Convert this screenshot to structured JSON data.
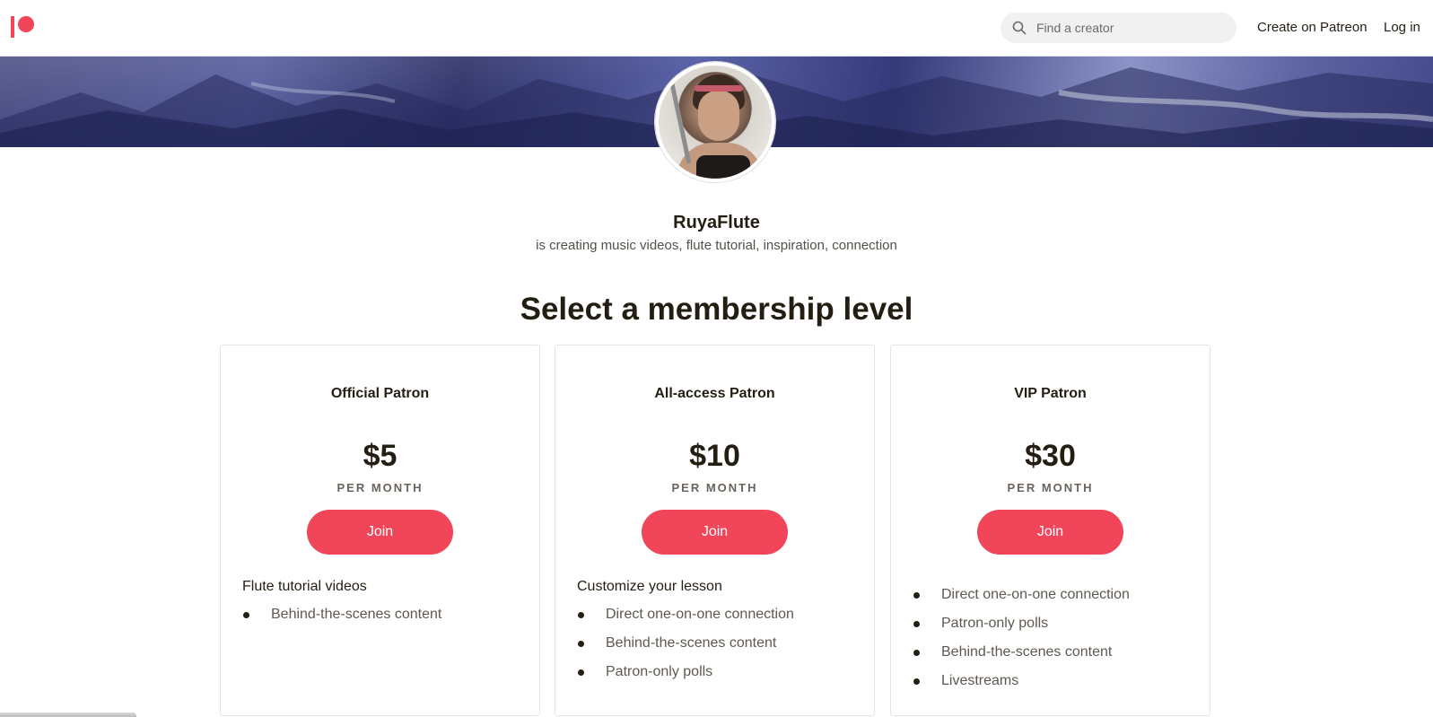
{
  "nav": {
    "search_placeholder": "Find a creator",
    "create_label": "Create on Patreon",
    "login_label": "Log in"
  },
  "creator": {
    "name": "RuyaFlute",
    "tagline": "is creating music videos, flute tutorial, inspiration, connection"
  },
  "section": {
    "title": "Select a membership level"
  },
  "tiers": [
    {
      "name": "Official Patron",
      "price": "$5",
      "period": "PER MONTH",
      "join_label": "Join",
      "description": "Flute tutorial videos",
      "benefits": [
        "Behind-the-scenes content"
      ]
    },
    {
      "name": "All-access Patron",
      "price": "$10",
      "period": "PER MONTH",
      "join_label": "Join",
      "description": "Customize your lesson",
      "benefits": [
        "Direct one-on-one connection",
        "Behind-the-scenes content",
        "Patron-only polls"
      ]
    },
    {
      "name": "VIP Patron",
      "price": "$30",
      "period": "PER MONTH",
      "join_label": "Join",
      "benefits": [
        "Direct one-on-one connection",
        "Patron-only polls",
        "Behind-the-scenes content",
        "Livestreams"
      ]
    }
  ],
  "colors": {
    "accent": "#f1465a",
    "text": "#241e12",
    "muted": "#5e5850"
  },
  "icons": {
    "logo": "patreon-logo",
    "search": "search-icon",
    "bullet": "bullet-icon"
  }
}
